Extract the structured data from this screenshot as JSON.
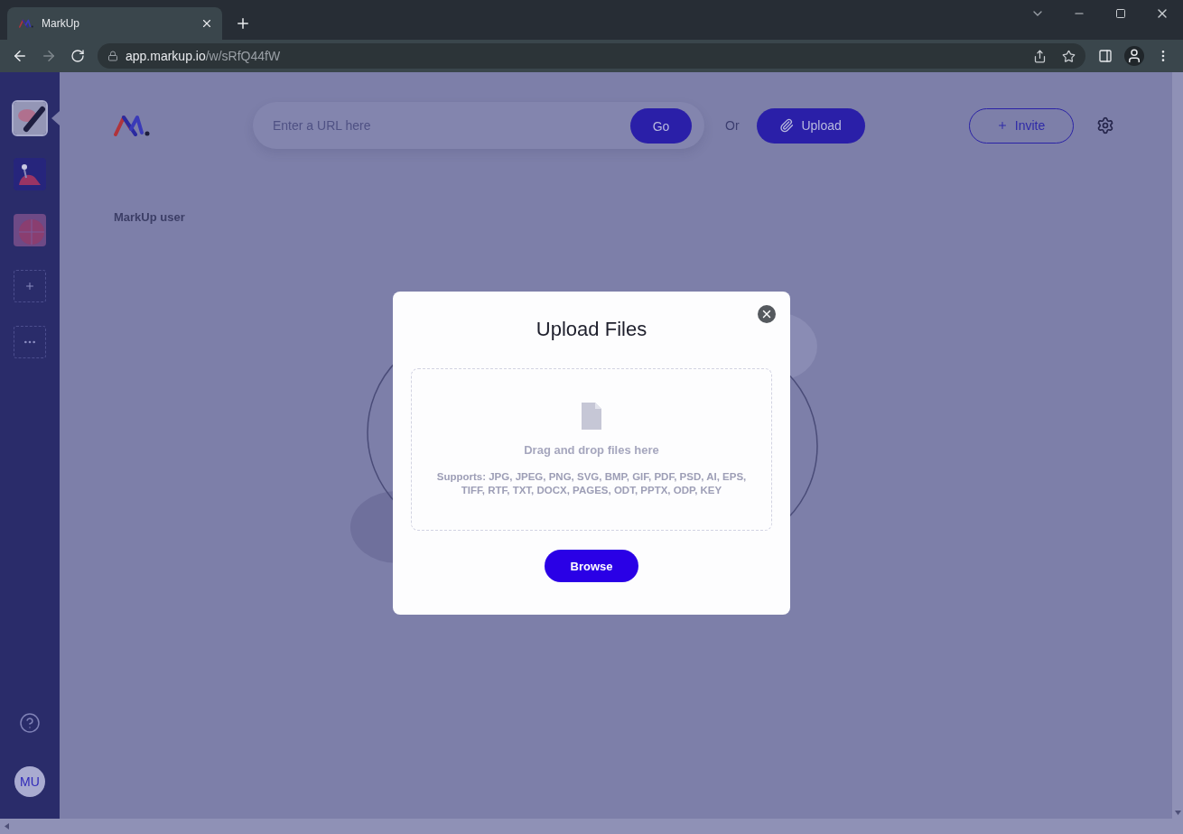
{
  "browser": {
    "tab": {
      "title": "MarkUp"
    },
    "address": {
      "host": "app.markup.io",
      "path": "/w/sRfQ44fW"
    }
  },
  "sidebar": {
    "workspaces": [
      {
        "kind": "brush",
        "selected": true
      },
      {
        "kind": "figure",
        "selected": false
      },
      {
        "kind": "sphere",
        "selected": false
      }
    ],
    "avatar": {
      "initials": "MU"
    }
  },
  "header": {
    "url_field": {
      "placeholder": "Enter a URL here"
    },
    "go_button": "Go",
    "separator": "Or",
    "upload_button": "Upload",
    "invite_button": "Invite"
  },
  "user_label": "MarkUp user",
  "modal": {
    "title": "Upload Files",
    "dropzone": {
      "prompt": "Drag and drop files here",
      "supports": "Supports: JPG, JPEG, PNG, SVG, BMP, GIF, PDF, PSD, AI, EPS, TIFF, RTF, TXT, DOCX, PAGES, ODT, PPTX, ODP, KEY"
    },
    "browse_button": "Browse"
  }
}
